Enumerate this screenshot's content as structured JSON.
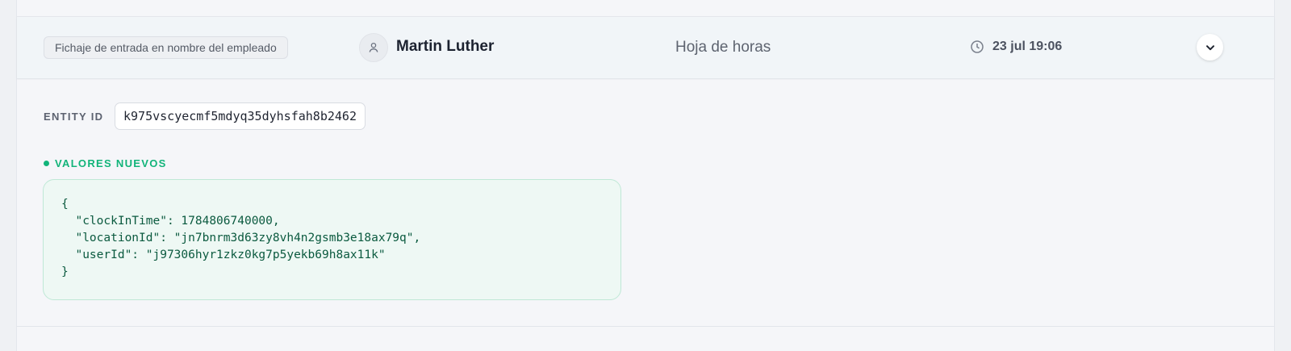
{
  "entry": {
    "action": "Fichaje de entrada en nombre del empleado",
    "user_name": "Martin Luther",
    "module": "Hoja de horas",
    "timestamp": "23 jul 19:06",
    "icons": {
      "avatar": "user-icon",
      "time": "clock-icon",
      "expand": "chevron-down-icon"
    }
  },
  "details": {
    "entity_id_label": "ENTITY ID",
    "entity_id": "k975vscyecmf5mdyq35dyhsfah8b2462",
    "new_values_label": "VALORES NUEVOS",
    "new_values_lines": [
      "{",
      "  \"clockInTime\": 1784806740000,",
      "  \"locationId\": \"jn7bnrm3d63zy8vh4n2gsmb3e18ax79q\",",
      "  \"userId\": \"j97306hyr1zkz0kg7p5yekb69h8ax11k\"",
      "}"
    ]
  },
  "colors": {
    "accent_green": "#12b47a",
    "json_text": "#0b5a3f",
    "json_bg": "#eef8f4",
    "header_bg": "#f1f5f8"
  }
}
